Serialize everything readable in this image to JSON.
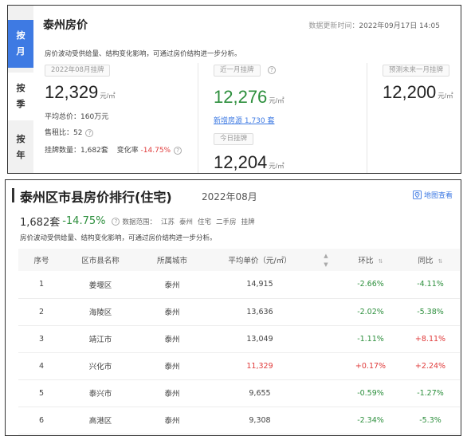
{
  "top": {
    "city_title": "泰州房价",
    "update_label": "数据更新时间：",
    "update_time": "2022年09月17日 14:05",
    "description": "房价波动受供给量、结构变化影响，可通过房价结构进一步分析。",
    "tabs": [
      {
        "line1": "按",
        "line2": "月"
      },
      {
        "line1": "按",
        "line2": "季"
      },
      {
        "line1": "按",
        "line2": "年"
      }
    ],
    "listing": {
      "tag": "2022年08月挂牌",
      "price": "12,329",
      "unit": "元/㎡",
      "avg_total_label": "平均总价：",
      "avg_total": "160万元",
      "rent_ratio_label": "售租比：",
      "rent_ratio": "52",
      "count_label": "挂牌数量：",
      "count": "1,682套",
      "change_label": "变化率",
      "change": "-14.75%"
    },
    "recent": {
      "tag": "近一月挂牌",
      "price": "12,276",
      "unit": "元/㎡",
      "new_link": "新增房源 1,730 套",
      "today_tag": "今日挂牌",
      "today_price": "12,204",
      "today_unit": "元/㎡"
    },
    "forecast": {
      "tag": "预测未来一月挂牌",
      "price": "12,200",
      "unit": "元/㎡"
    }
  },
  "ranking": {
    "title": "泰州区市县房价排行(住宅)",
    "date": "2022年08月",
    "map_link": "地图查看",
    "count": "1,682套",
    "change": "-14.75%",
    "scope_label": "数据范围：",
    "scope_items": [
      "江苏",
      "泰州",
      "住宅",
      "二手房",
      "挂牌"
    ],
    "description": "房价波动受供给量、结构变化影响，可通过房价结构进一步分析。",
    "columns": [
      "序号",
      "区市县名称",
      "所属城市",
      "平均单价（元/㎡）",
      "环比",
      "同比"
    ],
    "rows": [
      {
        "no": "1",
        "name": "姜堰区",
        "city": "泰州",
        "price": "14,915",
        "mom": "-2.66%",
        "yoy": "-4.11%"
      },
      {
        "no": "2",
        "name": "海陵区",
        "city": "泰州",
        "price": "13,636",
        "mom": "-2.02%",
        "yoy": "-5.38%"
      },
      {
        "no": "3",
        "name": "靖江市",
        "city": "泰州",
        "price": "13,049",
        "mom": "-1.11%",
        "yoy": "+8.11%"
      },
      {
        "no": "4",
        "name": "兴化市",
        "city": "泰州",
        "price": "11,329",
        "mom": "+0.17%",
        "yoy": "+2.24%"
      },
      {
        "no": "5",
        "name": "泰兴市",
        "city": "泰州",
        "price": "9,655",
        "mom": "-0.59%",
        "yoy": "-1.27%"
      },
      {
        "no": "6",
        "name": "高港区",
        "city": "泰州",
        "price": "9,308",
        "mom": "-2.34%",
        "yoy": "-5.3%"
      }
    ],
    "colors": {
      "down": "#2d8f3d",
      "up": "#e03a3a",
      "highlight_price": "#e03a3a"
    }
  }
}
